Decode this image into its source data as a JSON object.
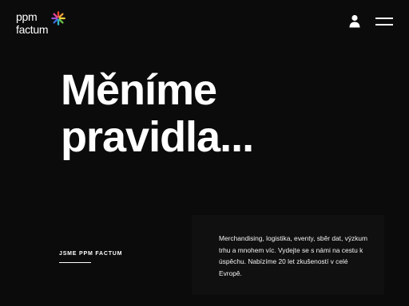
{
  "logo": {
    "line1": "ppm",
    "line2": "factum",
    "star_colors": [
      "#e8442e",
      "#f2a33a",
      "#f4d23b",
      "#6cc24a",
      "#2fb3c5",
      "#3a6fd8",
      "#9b4fd1",
      "#e2459a"
    ]
  },
  "header": {
    "user_icon": "user-icon",
    "menu_icon": "hamburger-menu-icon"
  },
  "hero": {
    "headline_line1": "Měníme",
    "headline_line2": "pravidla..."
  },
  "about": {
    "link_label": "JSME PPM FACTUM"
  },
  "info": {
    "text": "Merchandising, logistika, eventy, sběr dat, výzkum trhu a mnohem víc. Vydejte se s námi na cestu k úspěchu. Nabízíme 20 let zkušeností v celé Evropě."
  },
  "colors": {
    "background": "#0c0b0c",
    "card": "#111011",
    "text": "#ffffff"
  }
}
